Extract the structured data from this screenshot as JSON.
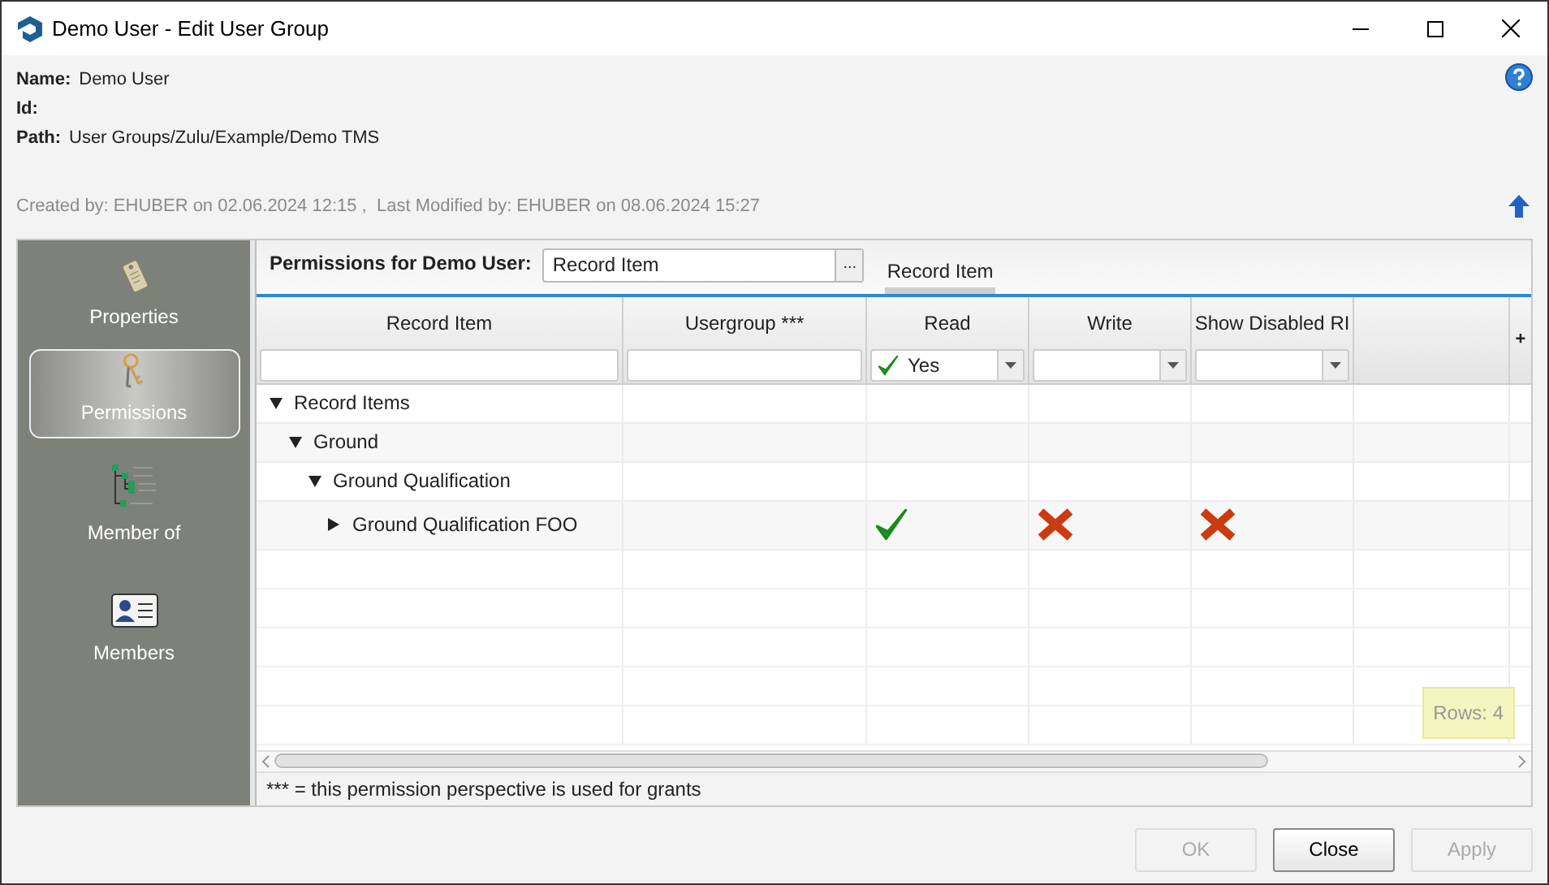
{
  "window": {
    "title": "Demo User - Edit User Group"
  },
  "info": [
    {
      "label": "Name:",
      "value": "Demo User"
    },
    {
      "label": "Id:"
    },
    {
      "label": "Path:",
      "value": "User Groups/Zulu/Example/Demo TMS"
    }
  ],
  "audit": "Created by: EHUBER on 02.06.2024 12:15 ,  Last Modified by: EHUBER on 08.06.2024 15:27",
  "sidebar": {
    "items": [
      {
        "label": "Properties",
        "selected": false
      },
      {
        "label": "Permissions",
        "selected": true
      },
      {
        "label": "Member of",
        "selected": false
      },
      {
        "label": "Members",
        "selected": false
      }
    ]
  },
  "perspective": {
    "label": "Permissions for Demo User:",
    "value": "Record Item",
    "browse": "...",
    "tabs": [
      {
        "label": "Record Item",
        "selected": true
      }
    ]
  },
  "table": {
    "columns": [
      {
        "label": "Record Item",
        "filter": {
          "kind": "text"
        }
      },
      {
        "label": "Usergroup ***",
        "filter": {
          "kind": "text"
        }
      },
      {
        "label": "Read",
        "filter": {
          "kind": "dropdown",
          "value": "Yes",
          "checked": true
        }
      },
      {
        "label": "Write",
        "filter": {
          "kind": "dropdown"
        }
      },
      {
        "label": "Show Disabled RI",
        "filter": {
          "kind": "dropdown"
        }
      }
    ],
    "add": "+",
    "rows": [
      {
        "label": "Record Items",
        "expanded": true,
        "children": [
          {
            "label": "Ground",
            "expanded": true,
            "children": [
              {
                "label": "Ground Qualification",
                "expanded": true,
                "children": [
                  {
                    "label": "Ground Qualification FOO",
                    "expanded": false,
                    "read": true,
                    "write": false,
                    "show_disabled": false
                  }
                ]
              }
            ]
          }
        ]
      }
    ],
    "row_count": "Rows: 4",
    "footnote": "*** = this permission perspective is used for grants"
  },
  "buttons": [
    {
      "label": "OK",
      "disabled": true
    },
    {
      "label": "Close",
      "disabled": false
    },
    {
      "label": "Apply",
      "disabled": true
    }
  ]
}
